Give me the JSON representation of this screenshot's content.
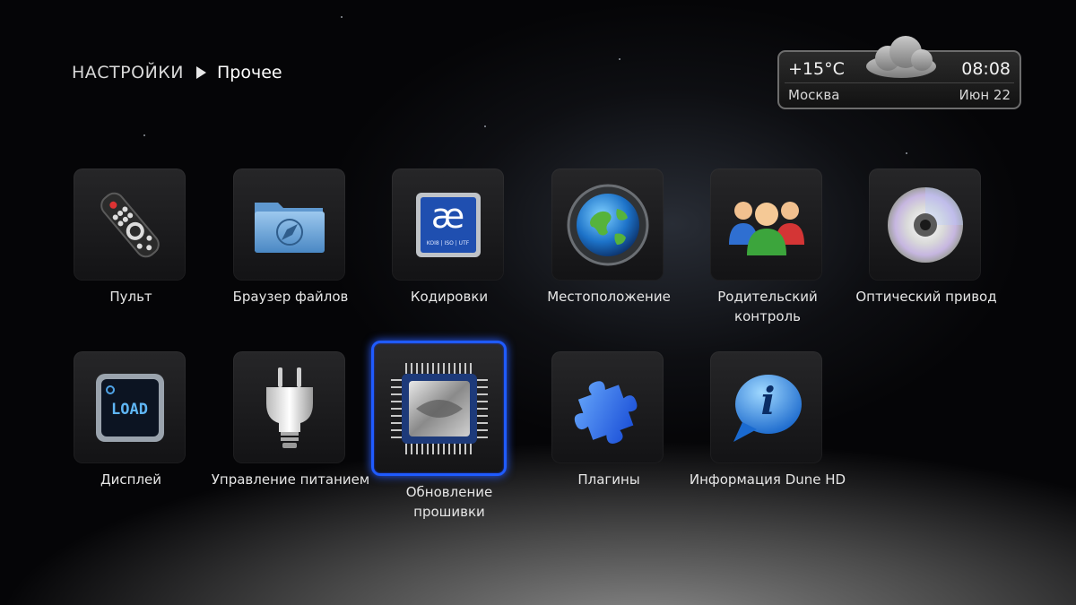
{
  "breadcrumb": {
    "root": "НАСТРОЙКИ",
    "current": "Прочее"
  },
  "weather": {
    "temperature": "+15°C",
    "time": "08:08",
    "city": "Москва",
    "date": "Июн 22",
    "icon": "cloud-icon"
  },
  "tiles": [
    {
      "label": "Пульт",
      "icon": "remote-control-icon"
    },
    {
      "label": "Браузер файлов",
      "icon": "folder-compass-icon"
    },
    {
      "label": "Кодировки",
      "icon": "encoding-ae-icon",
      "icon_text": "æ",
      "icon_subtext": "KOI8 | ISO | UTF"
    },
    {
      "label": "Местоположение",
      "icon": "globe-icon"
    },
    {
      "label": "Родительский контроль",
      "icon": "parents-icon"
    },
    {
      "label": "Оптический привод",
      "icon": "optical-disc-icon"
    },
    {
      "label": "Дисплей",
      "icon": "display-lcd-icon",
      "icon_text": "LOAD"
    },
    {
      "label": "Управление питанием",
      "icon": "power-plug-icon"
    },
    {
      "label": "Обновление прошивки",
      "icon": "chip-icon",
      "selected": true
    },
    {
      "label": "Плагины",
      "icon": "puzzle-icon"
    },
    {
      "label": "Информация Dune HD",
      "icon": "info-bubble-icon",
      "icon_text": "i"
    }
  ]
}
